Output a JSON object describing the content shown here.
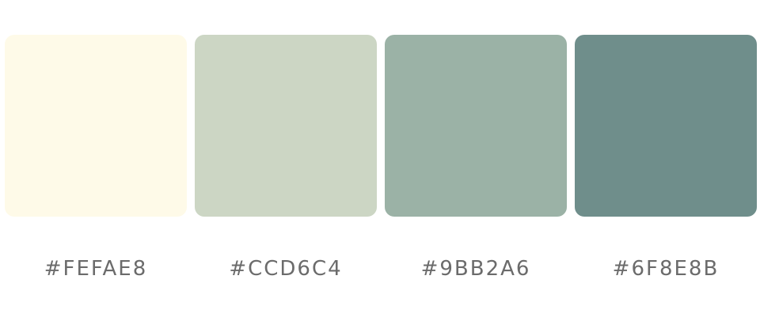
{
  "swatches": [
    {
      "hex_label": "#FEFAE8",
      "color": "#FEFAE8"
    },
    {
      "hex_label": "#CCD6C4",
      "color": "#CCD6C4"
    },
    {
      "hex_label": "#9BB2A6",
      "color": "#9BB2A6"
    },
    {
      "hex_label": "#6F8E8B",
      "color": "#6F8E8B"
    }
  ]
}
